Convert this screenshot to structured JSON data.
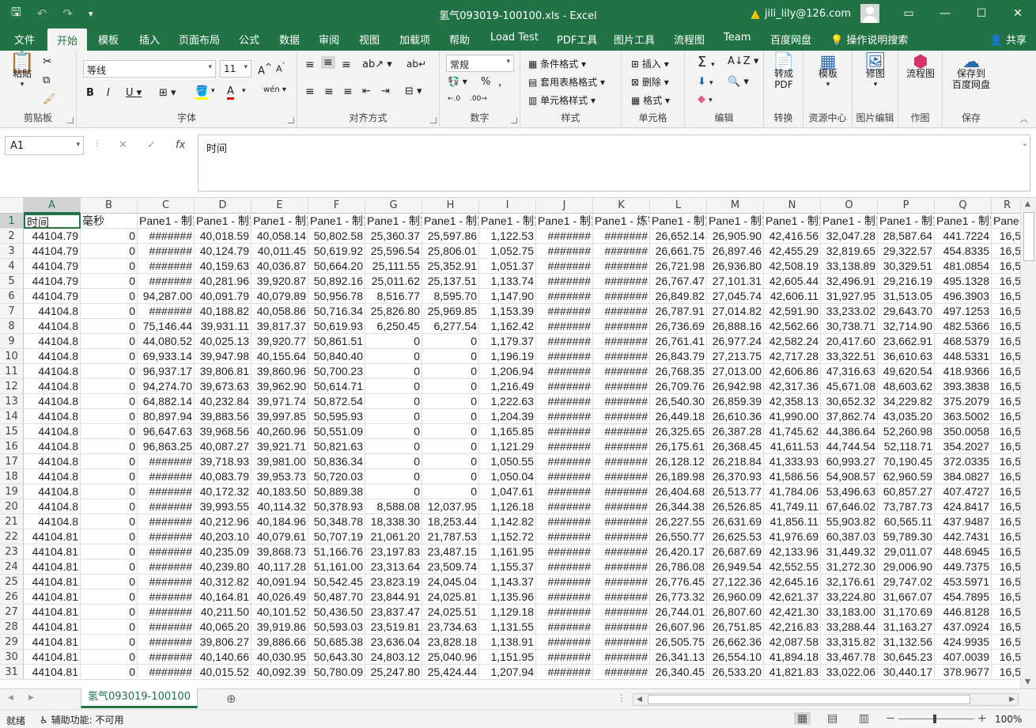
{
  "titlebar": {
    "file_title": "氢气093019-100100.xls  -  Excel",
    "user": "jili_lily@126.com"
  },
  "tabs": [
    "文件",
    "开始",
    "模板",
    "插入",
    "页面布局",
    "公式",
    "数据",
    "审阅",
    "视图",
    "加载项",
    "帮助",
    "Load Test",
    "PDF工具",
    "图片工具",
    "流程图",
    "Team",
    "百度网盘",
    "操作说明搜索"
  ],
  "share_label": "共享",
  "ribbon": {
    "clipboard": {
      "paste": "粘贴",
      "label": "剪贴板"
    },
    "font": {
      "name": "等线",
      "size": "11",
      "label": "字体"
    },
    "align": {
      "label": "对齐方式"
    },
    "number": {
      "format": "常规",
      "label": "数字"
    },
    "styles": {
      "cond": "条件格式",
      "table": "套用表格格式",
      "cell": "单元格样式",
      "label": "样式"
    },
    "cells": {
      "insert": "插入",
      "delete": "删除",
      "format": "格式",
      "label": "单元格"
    },
    "editing": {
      "label": "编辑"
    },
    "convert": {
      "btn": "转成",
      "btn2": "PDF",
      "label": "转换"
    },
    "template": {
      "btn": "模板",
      "label": "资源中心"
    },
    "img": {
      "btn": "修图",
      "label": "图片编辑"
    },
    "draw": {
      "btn": "流程图",
      "label": "作图"
    },
    "save": {
      "btn": "保存到",
      "btn2": "百度网盘",
      "label": "保存"
    }
  },
  "formula_bar": {
    "name_box": "A1",
    "content": "时间"
  },
  "columns": [
    "A",
    "B",
    "C",
    "D",
    "E",
    "F",
    "G",
    "H",
    "I",
    "J",
    "K",
    "L",
    "M",
    "N",
    "O",
    "P",
    "Q",
    "R"
  ],
  "header_row": [
    "时间",
    "毫秒",
    "Pane1 - 制氢",
    "Pane1 - 制氢",
    "Pane1 - 制氢",
    "Pane1 - 制氢",
    "Pane1 - 制氢",
    "Pane1 - 制氢",
    "Pane1 - 制氢",
    "Pane1 - 制氢",
    "Pane1 - 炼钢",
    "Pane1 - 制氢",
    "Pane1 - 制氢",
    "Pane1 - 制氢",
    "Pane1 - 制氢",
    "Pane1 - 制氢",
    "Pane1 - 制氢",
    "Pane"
  ],
  "rows": [
    [
      "44104.79",
      "0",
      "#######",
      "40,018.59",
      "40,058.14",
      "50,802.58",
      "25,360.37",
      "25,597.86",
      "1,122.53",
      "#######",
      "#######",
      "26,652.14",
      "26,905.90",
      "42,416.56",
      "32,047.28",
      "28,587.64",
      "441.7224",
      "16,5"
    ],
    [
      "44104.79",
      "0",
      "#######",
      "40,124.79",
      "40,011.45",
      "50,619.92",
      "25,596.54",
      "25,806.01",
      "1,052.75",
      "#######",
      "#######",
      "26,661.75",
      "26,897.46",
      "42,455.29",
      "32,819.65",
      "29,322.57",
      "454.8335",
      "16,5"
    ],
    [
      "44104.79",
      "0",
      "#######",
      "40,159.63",
      "40,036.87",
      "50,664.20",
      "25,111.55",
      "25,352.91",
      "1,051.37",
      "#######",
      "#######",
      "26,721.98",
      "26,936.80",
      "42,508.19",
      "33,138.89",
      "30,329.51",
      "481.0854",
      "16,5"
    ],
    [
      "44104.79",
      "0",
      "#######",
      "40,281.96",
      "39,920.87",
      "50,892.16",
      "25,011.62",
      "25,137.51",
      "1,133.74",
      "#######",
      "#######",
      "26,767.47",
      "27,101.31",
      "42,605.44",
      "32,496.91",
      "29,216.19",
      "495.1328",
      "16,5"
    ],
    [
      "44104.79",
      "0",
      "94,287.00",
      "40,091.79",
      "40,079.89",
      "50,956.78",
      "8,516.77",
      "8,595.70",
      "1,147.90",
      "#######",
      "#######",
      "26,849.82",
      "27,045.74",
      "42,606.11",
      "31,927.95",
      "31,513.05",
      "496.3903",
      "16,5"
    ],
    [
      "44104.8",
      "0",
      "#######",
      "40,188.82",
      "40,058.86",
      "50,716.34",
      "25,826.80",
      "25,969.85",
      "1,153.39",
      "#######",
      "#######",
      "26,787.91",
      "27,014.82",
      "42,591.90",
      "33,233.02",
      "29,643.70",
      "497.1253",
      "16,5"
    ],
    [
      "44104.8",
      "0",
      "75,146.44",
      "39,931.11",
      "39,817.37",
      "50,619.93",
      "6,250.45",
      "6,277.54",
      "1,162.42",
      "#######",
      "#######",
      "26,736.69",
      "26,888.16",
      "42,562.66",
      "30,738.71",
      "32,714.90",
      "482.5366",
      "16,5"
    ],
    [
      "44104.8",
      "0",
      "44,080.52",
      "40,025.13",
      "39,920.77",
      "50,861.51",
      "0",
      "0",
      "1,179.37",
      "#######",
      "#######",
      "26,761.41",
      "26,977.24",
      "42,582.24",
      "20,417.60",
      "23,662.91",
      "468.5379",
      "16,5"
    ],
    [
      "44104.8",
      "0",
      "69,933.14",
      "39,947.98",
      "40,155.64",
      "50,840.40",
      "0",
      "0",
      "1,196.19",
      "#######",
      "#######",
      "26,843.79",
      "27,213.75",
      "42,717.28",
      "33,322.51",
      "36,610.63",
      "448.5331",
      "16,5"
    ],
    [
      "44104.8",
      "0",
      "96,937.17",
      "39,806.81",
      "39,860.96",
      "50,700.23",
      "0",
      "0",
      "1,206.94",
      "#######",
      "#######",
      "26,768.35",
      "27,013.00",
      "42,606.86",
      "47,316.63",
      "49,620.54",
      "418.9366",
      "16,5"
    ],
    [
      "44104.8",
      "0",
      "94,274.70",
      "39,673.63",
      "39,962.90",
      "50,614.71",
      "0",
      "0",
      "1,216.49",
      "#######",
      "#######",
      "26,709.76",
      "26,942.98",
      "42,317.36",
      "45,671.08",
      "48,603.62",
      "393.3838",
      "16,5"
    ],
    [
      "44104.8",
      "0",
      "64,882.14",
      "40,232.84",
      "39,971.74",
      "50,872.54",
      "0",
      "0",
      "1,222.63",
      "#######",
      "#######",
      "26,540.30",
      "26,859.39",
      "42,358.13",
      "30,652.32",
      "34,229.82",
      "375.2079",
      "16,5"
    ],
    [
      "44104.8",
      "0",
      "80,897.94",
      "39,883.56",
      "39,997.85",
      "50,595.93",
      "0",
      "0",
      "1,204.39",
      "#######",
      "#######",
      "26,449.18",
      "26,610.36",
      "41,990.00",
      "37,862.74",
      "43,035.20",
      "363.5002",
      "16,5"
    ],
    [
      "44104.8",
      "0",
      "96,647.63",
      "39,968.56",
      "40,260.96",
      "50,551.09",
      "0",
      "0",
      "1,165.85",
      "#######",
      "#######",
      "26,325.65",
      "26,387.28",
      "41,745.62",
      "44,386.64",
      "52,260.98",
      "350.0058",
      "16,5"
    ],
    [
      "44104.8",
      "0",
      "96,863.25",
      "40,087.27",
      "39,921.71",
      "50,821.63",
      "0",
      "0",
      "1,121.29",
      "#######",
      "#######",
      "26,175.61",
      "26,368.45",
      "41,611.53",
      "44,744.54",
      "52,118.71",
      "354.2027",
      "16,5"
    ],
    [
      "44104.8",
      "0",
      "#######",
      "39,718.93",
      "39,981.00",
      "50,836.34",
      "0",
      "0",
      "1,050.55",
      "#######",
      "#######",
      "26,128.12",
      "26,218.84",
      "41,333.93",
      "60,993.27",
      "70,190.45",
      "372.0335",
      "16,5"
    ],
    [
      "44104.8",
      "0",
      "#######",
      "40,083.79",
      "39,953.73",
      "50,720.03",
      "0",
      "0",
      "1,050.04",
      "#######",
      "#######",
      "26,189.98",
      "26,370.93",
      "41,586.56",
      "54,908.57",
      "62,960.59",
      "384.0827",
      "16,5"
    ],
    [
      "44104.8",
      "0",
      "#######",
      "40,172.32",
      "40,183.50",
      "50,889.38",
      "0",
      "0",
      "1,047.61",
      "#######",
      "#######",
      "26,404.68",
      "26,513.77",
      "41,784.06",
      "53,496.63",
      "60,857.27",
      "407.4727",
      "16,5"
    ],
    [
      "44104.8",
      "0",
      "#######",
      "39,993.55",
      "40,114.32",
      "50,378.93",
      "8,588.08",
      "12,037.95",
      "1,126.18",
      "#######",
      "#######",
      "26,344.38",
      "26,526.85",
      "41,749.11",
      "67,646.02",
      "73,787.73",
      "424.8417",
      "16,5"
    ],
    [
      "44104.8",
      "0",
      "#######",
      "40,212.96",
      "40,184.96",
      "50,348.78",
      "18,338.30",
      "18,253.44",
      "1,142.82",
      "#######",
      "#######",
      "26,227.55",
      "26,631.69",
      "41,856.11",
      "55,903.82",
      "60,565.11",
      "437.9487",
      "16,5"
    ],
    [
      "44104.81",
      "0",
      "#######",
      "40,203.10",
      "40,079.61",
      "50,707.19",
      "21,061.20",
      "21,787.53",
      "1,152.72",
      "#######",
      "#######",
      "26,550.77",
      "26,625.53",
      "41,976.69",
      "60,387.03",
      "59,789.30",
      "442.7431",
      "16,5"
    ],
    [
      "44104.81",
      "0",
      "#######",
      "40,235.09",
      "39,868.73",
      "51,166.76",
      "23,197.83",
      "23,487.15",
      "1,161.95",
      "#######",
      "#######",
      "26,420.17",
      "26,687.69",
      "42,133.96",
      "31,449.32",
      "29,011.07",
      "448.6945",
      "16,5"
    ],
    [
      "44104.81",
      "0",
      "#######",
      "40,239.80",
      "40,117.28",
      "51,161.00",
      "23,313.64",
      "23,509.74",
      "1,155.37",
      "#######",
      "#######",
      "26,786.08",
      "26,949.54",
      "42,552.55",
      "31,272.30",
      "29,006.90",
      "449.7375",
      "16,5"
    ],
    [
      "44104.81",
      "0",
      "#######",
      "40,312.82",
      "40,091.94",
      "50,542.45",
      "23,823.19",
      "24,045.04",
      "1,143.37",
      "#######",
      "#######",
      "26,776.45",
      "27,122.36",
      "42,645.16",
      "32,176.61",
      "29,747.02",
      "453.5971",
      "16,5"
    ],
    [
      "44104.81",
      "0",
      "#######",
      "40,164.81",
      "40,026.49",
      "50,487.70",
      "23,844.91",
      "24,025.81",
      "1,135.96",
      "#######",
      "#######",
      "26,773.32",
      "26,960.09",
      "42,621.37",
      "33,224.80",
      "31,667.07",
      "454.7895",
      "16,5"
    ],
    [
      "44104.81",
      "0",
      "#######",
      "40,211.50",
      "40,101.52",
      "50,436.50",
      "23,837.47",
      "24,025.51",
      "1,129.18",
      "#######",
      "#######",
      "26,744.01",
      "26,807.60",
      "42,421.30",
      "33,183.00",
      "31,170.69",
      "446.8128",
      "16,5"
    ],
    [
      "44104.81",
      "0",
      "#######",
      "40,065.20",
      "39,919.86",
      "50,593.03",
      "23,519.81",
      "23,734.63",
      "1,131.55",
      "#######",
      "#######",
      "26,607.96",
      "26,751.85",
      "42,216.83",
      "33,288.44",
      "31,163.27",
      "437.0924",
      "16,5"
    ],
    [
      "44104.81",
      "0",
      "#######",
      "39,806.27",
      "39,886.66",
      "50,685.38",
      "23,636.04",
      "23,828.18",
      "1,138.91",
      "#######",
      "#######",
      "26,505.75",
      "26,662.36",
      "42,087.58",
      "33,315.82",
      "31,132.56",
      "424.9935",
      "16,5"
    ],
    [
      "44104.81",
      "0",
      "#######",
      "40,140.66",
      "40,030.95",
      "50,643.30",
      "24,803.12",
      "25,040.96",
      "1,151.95",
      "#######",
      "#######",
      "26,341.13",
      "26,554.10",
      "41,894.18",
      "33,467.78",
      "30,645.23",
      "407.0039",
      "16,5"
    ],
    [
      "44104.81",
      "0",
      "#######",
      "40,015.52",
      "40,092.39",
      "50,780.09",
      "25,247.80",
      "25,424.44",
      "1,207.94",
      "#######",
      "#######",
      "26,340.45",
      "26,533.20",
      "41,821.83",
      "33,022.06",
      "30,440.17",
      "378.9677",
      "16,5"
    ]
  ],
  "sheet_tab": "氢气093019-100100",
  "status": {
    "ready": "就绪",
    "accessibility": "辅助功能: 不可用",
    "zoom": "100%"
  },
  "colors": {
    "excel_green": "#217346"
  }
}
